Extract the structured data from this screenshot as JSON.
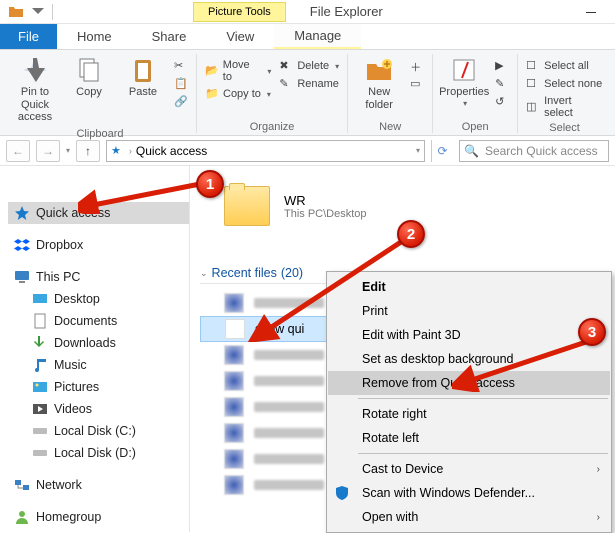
{
  "titlebar": {
    "context_tab": "Picture Tools",
    "app_title": "File Explorer"
  },
  "tabs": {
    "file": "File",
    "home": "Home",
    "share": "Share",
    "view": "View",
    "manage": "Manage"
  },
  "ribbon": {
    "clipboard": {
      "label": "Clipboard",
      "pin": "Pin to Quick access",
      "copy": "Copy",
      "paste": "Paste"
    },
    "organize": {
      "label": "Organize",
      "move": "Move to",
      "copy": "Copy to",
      "delete": "Delete",
      "rename": "Rename"
    },
    "new": {
      "label": "New",
      "newfolder": "New folder"
    },
    "open": {
      "label": "Open",
      "properties": "Properties"
    },
    "select": {
      "label": "Select",
      "all": "Select all",
      "none": "Select none",
      "invert": "Invert select"
    }
  },
  "address": {
    "crumb1": "Quick access",
    "search_placeholder": "Search Quick access"
  },
  "nav": {
    "quick_access": "Quick access",
    "dropbox": "Dropbox",
    "this_pc": "This PC",
    "desktop": "Desktop",
    "documents": "Documents",
    "downloads": "Downloads",
    "music": "Music",
    "pictures": "Pictures",
    "videos": "Videos",
    "localc": "Local Disk (C:)",
    "locald": "Local Disk (D:)",
    "network": "Network",
    "homegroup": "Homegroup"
  },
  "content": {
    "folder_name": "WR",
    "folder_path": "This PC\\Desktop",
    "section_head_prefix": "Recent files ",
    "section_count": "(20)",
    "selected_item_name": "show qui"
  },
  "context_menu": {
    "edit": "Edit",
    "print": "Print",
    "paint3d": "Edit with Paint 3D",
    "setbg": "Set as desktop background",
    "remove_qa": "Remove from Quick access",
    "rotate_r": "Rotate right",
    "rotate_l": "Rotate left",
    "cast": "Cast to Device",
    "defender": "Scan with Windows Defender...",
    "open_with": "Open with"
  },
  "badges": {
    "b1": "1",
    "b2": "2",
    "b3": "3"
  }
}
